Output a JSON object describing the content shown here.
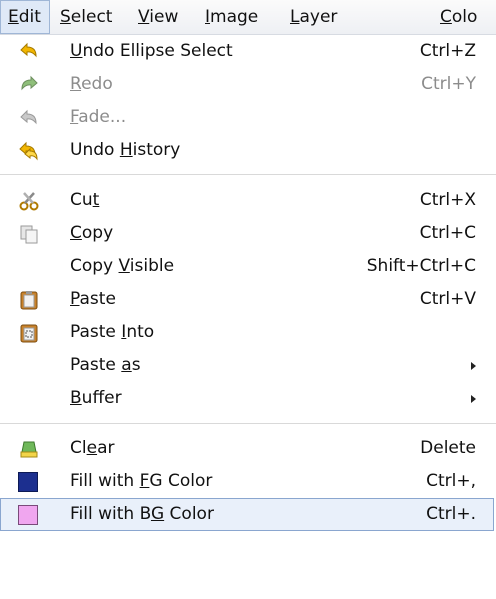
{
  "menubar": {
    "items": [
      {
        "pre": "",
        "u": "E",
        "post": "dit"
      },
      {
        "pre": "",
        "u": "S",
        "post": "elect"
      },
      {
        "pre": "",
        "u": "V",
        "post": "iew"
      },
      {
        "pre": "",
        "u": "I",
        "post": "mage"
      },
      {
        "pre": "",
        "u": "L",
        "post": "ayer"
      },
      {
        "pre": "",
        "u": "C",
        "post": "olo"
      }
    ]
  },
  "menu": {
    "undo": {
      "pre": "",
      "u": "U",
      "post": "ndo Ellipse Select",
      "accel": "Ctrl+Z",
      "icon": "undo-icon"
    },
    "redo": {
      "pre": "",
      "u": "R",
      "post": "edo",
      "accel": "Ctrl+Y",
      "icon": "redo-icon"
    },
    "fade": {
      "pre": "",
      "u": "F",
      "post": "ade...",
      "accel": "",
      "icon": "fade-icon"
    },
    "undo_history": {
      "pre": "Undo ",
      "u": "H",
      "post": "istory",
      "accel": "",
      "icon": "undo-history-icon"
    },
    "cut": {
      "pre": "Cu",
      "u": "t",
      "post": "",
      "accel": "Ctrl+X",
      "icon": "scissors-icon"
    },
    "copy": {
      "pre": "",
      "u": "C",
      "post": "opy",
      "accel": "Ctrl+C",
      "icon": "copy-icon"
    },
    "copy_visible": {
      "pre": "Copy ",
      "u": "V",
      "post": "isible",
      "accel": "Shift+Ctrl+C"
    },
    "paste": {
      "pre": "",
      "u": "P",
      "post": "aste",
      "accel": "Ctrl+V",
      "icon": "paste-icon"
    },
    "paste_into": {
      "pre": "Paste ",
      "u": "I",
      "post": "nto",
      "accel": "",
      "icon": "paste-into-icon"
    },
    "paste_as": {
      "pre": "Paste ",
      "u": "a",
      "post": "s",
      "accel": ""
    },
    "buffer": {
      "pre": "",
      "u": "B",
      "post": "uffer",
      "accel": ""
    },
    "clear": {
      "pre": "Cl",
      "u": "e",
      "post": "ar",
      "accel": "Delete",
      "icon": "eraser-icon"
    },
    "fill_fg": {
      "pre": "Fill with ",
      "u": "F",
      "post": "G Color",
      "accel": "Ctrl+,",
      "color": "#1c2f8f"
    },
    "fill_bg": {
      "pre": "Fill with B",
      "u": "G",
      "post": " Color",
      "accel": "Ctrl+.",
      "color": "#f0a6ef"
    }
  }
}
